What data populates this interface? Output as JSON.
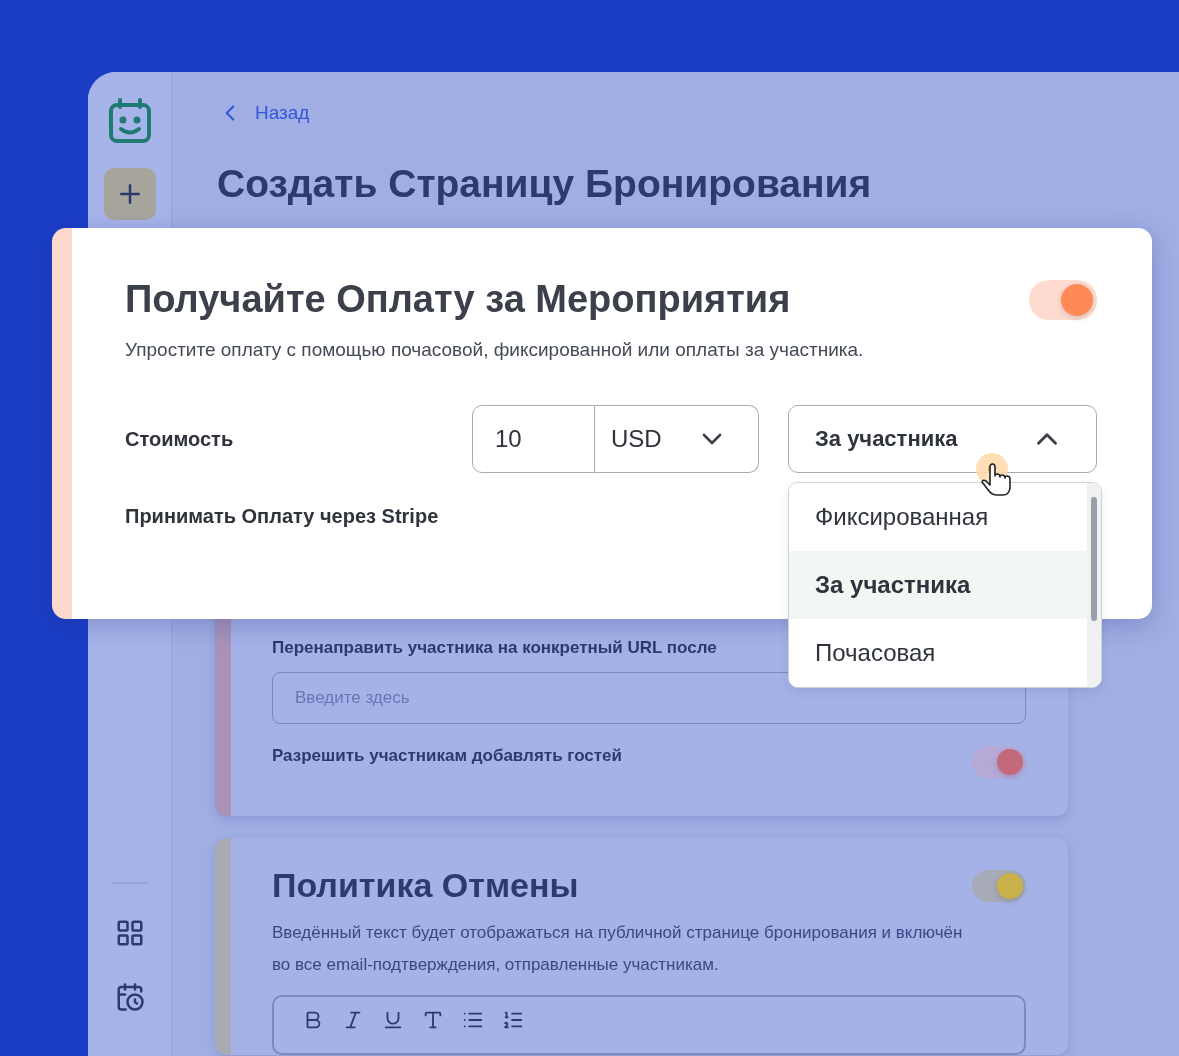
{
  "header": {
    "back": "Назад",
    "title": "Создать Страницу Бронирования"
  },
  "payment_card": {
    "title": "Получайте Оплату за Мероприятия",
    "enabled": true,
    "description": "Упростите оплату с помощью почасовой, фиксированной или оплаты за участника.",
    "price_label": "Стоимость",
    "amount": "10",
    "currency": "USD",
    "pricing_type": {
      "value": "За участника",
      "expanded": true,
      "options": [
        {
          "label": "Фиксированная",
          "selected": false
        },
        {
          "label": "За участника",
          "selected": true
        },
        {
          "label": "Почасовая",
          "selected": false
        }
      ]
    },
    "stripe_label": "Принимать Оплату через Stripe"
  },
  "redirect_card": {
    "url_label": "Перенаправить участника на конкретный URL после",
    "url_placeholder": "Введите здесь",
    "guests_label": "Разрешить участникам добавлять гостей",
    "guests_enabled": true
  },
  "cancellation_card": {
    "title": "Политика Отмены",
    "enabled": true,
    "description": "Введённый текст будет отображаться на публичной странице бронирования и включён во все email-подтверждения, отправленные участникам."
  }
}
